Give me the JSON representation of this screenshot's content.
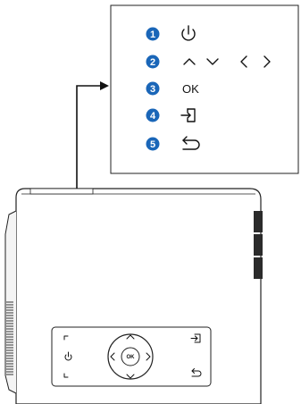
{
  "legend": {
    "items": [
      {
        "number": "1",
        "icon": "power-icon"
      },
      {
        "number": "2",
        "icon": "navigation-arrows-icon"
      },
      {
        "number": "3",
        "icon": "ok-label",
        "text": "OK"
      },
      {
        "number": "4",
        "icon": "source-input-icon"
      },
      {
        "number": "5",
        "icon": "back-return-icon"
      }
    ],
    "badge_color": "#1a66b8"
  },
  "panel": {
    "ok_label": "OK"
  }
}
